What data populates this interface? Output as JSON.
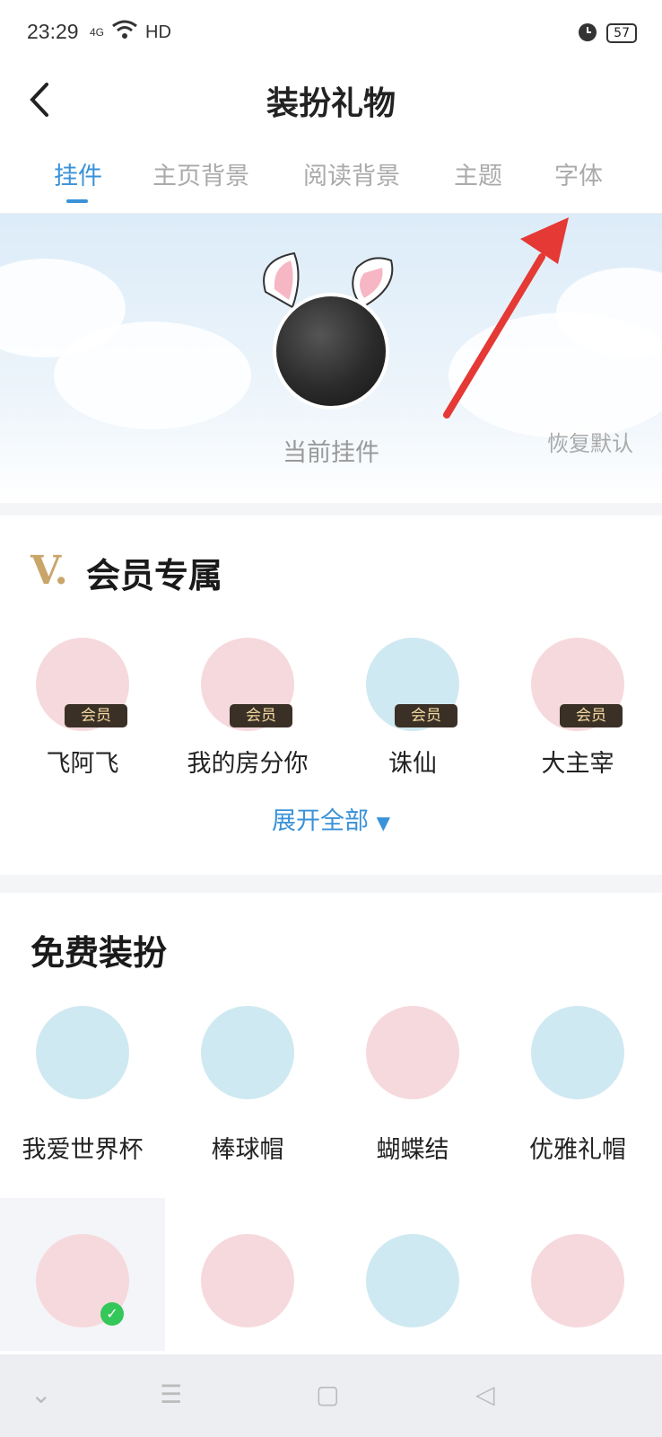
{
  "status": {
    "time": "23:29",
    "signal": "4G",
    "network": "HD",
    "battery": "57"
  },
  "header": {
    "title": "装扮礼物"
  },
  "tabs": [
    "挂件",
    "主页背景",
    "阅读背景",
    "主题",
    "字体"
  ],
  "banner": {
    "current_label": "当前挂件",
    "restore": "恢复默认"
  },
  "vip_section": {
    "logo": "V.",
    "title": "会员专属",
    "badge": "会员",
    "items": [
      {
        "label": "飞阿飞",
        "color": "#f6d9dd"
      },
      {
        "label": "我的房分你",
        "color": "#f6d9dd"
      },
      {
        "label": "诛仙",
        "color": "#cfe9f2"
      },
      {
        "label": "大主宰",
        "color": "#f6d9dd"
      }
    ],
    "expand": "展开全部"
  },
  "free_section": {
    "title": "免费装扮",
    "items": [
      {
        "label": "我爱世界杯",
        "color": "#cfe9f2"
      },
      {
        "label": "棒球帽",
        "color": "#cfe9f2"
      },
      {
        "label": "蝴蝶结",
        "color": "#f6d9dd"
      },
      {
        "label": "优雅礼帽",
        "color": "#cfe9f2"
      }
    ],
    "items_row2": [
      {
        "color": "#f6d9dd"
      },
      {
        "color": "#f6d9dd"
      },
      {
        "color": "#cfe9f2"
      },
      {
        "color": "#f6d9dd"
      }
    ]
  },
  "colors": {
    "accent": "#3a92d8",
    "annotation_arrow": "#e53935",
    "vip_gold": "#c9a56a"
  }
}
